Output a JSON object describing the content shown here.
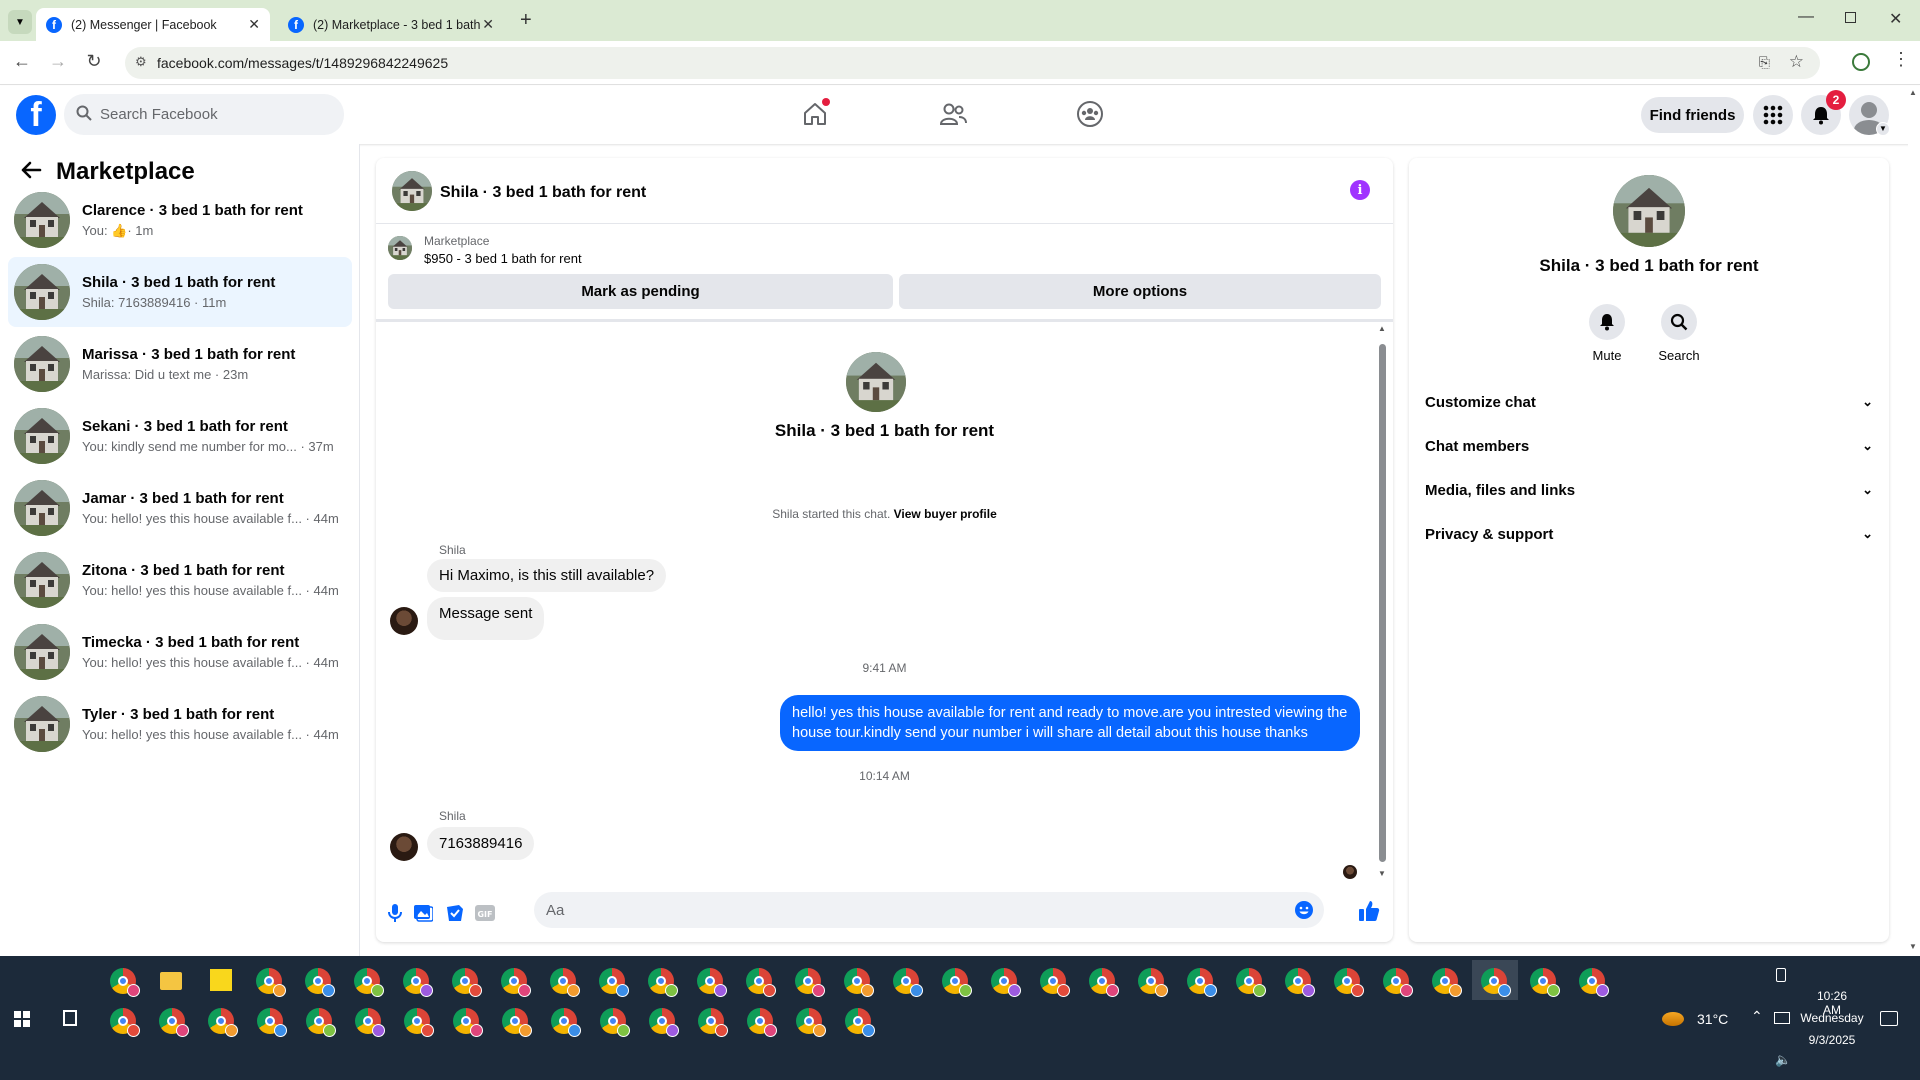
{
  "browser": {
    "tabs": [
      {
        "title": "(2) Messenger | Facebook",
        "active": true
      },
      {
        "title": "(2) Marketplace - 3 bed 1 bath",
        "active": false
      }
    ],
    "url": "facebook.com/messages/t/1489296842249625"
  },
  "header": {
    "search_placeholder": "Search Facebook",
    "find_friends": "Find friends",
    "notification_count": "2",
    "brand_color": "#0866ff"
  },
  "sidebar": {
    "title": "Marketplace",
    "conversations": [
      {
        "name": "Clarence · 3 bed 1 bath for rent",
        "preview": "You: ",
        "time": "· 1m",
        "has_like": true
      },
      {
        "name": "Shila · 3 bed 1 bath for rent",
        "preview": "Shila: 7163889416 · 11m",
        "selected": true
      },
      {
        "name": "Marissa · 3 bed 1 bath for rent",
        "preview": "Marissa: Did u text me · 23m"
      },
      {
        "name": "Sekani · 3 bed 1 bath for rent",
        "preview": "You: kindly send me number for mo... · 37m"
      },
      {
        "name": "Jamar · 3 bed 1 bath for rent",
        "preview": "You: hello! yes this house available f... · 44m"
      },
      {
        "name": "Zitona · 3 bed 1 bath for rent",
        "preview": "You: hello! yes this house available f... · 44m"
      },
      {
        "name": "Timecka · 3 bed 1 bath for rent",
        "preview": "You: hello! yes this house available f... · 44m"
      },
      {
        "name": "Tyler · 3 bed 1 bath for rent",
        "preview": "You: hello! yes this house available f... · 44m"
      }
    ]
  },
  "chat": {
    "title": "Shila · 3 bed 1 bath for rent",
    "marketplace_label": "Marketplace",
    "listing": "$950 - 3 bed 1 bath for rent",
    "mark_pending": "Mark as pending",
    "more_options": "More options",
    "intro_name": "Shila · 3 bed 1 bath for rent",
    "started_text": "Shila started this chat. ",
    "view_profile": "View buyer profile",
    "sender1": "Shila",
    "msg1": "Hi Maximo, is this still available?",
    "msg2": "Message sent",
    "time1": "9:41 AM",
    "my_msg": "hello! yes this house available for rent and ready to move.are you intrested viewing the house tour.kindly send your number i will share all detail about this house thanks",
    "time2": "10:14 AM",
    "sender2": "Shila",
    "msg3": "7163889416",
    "composer_placeholder": "Aa"
  },
  "details": {
    "name": "Shila · 3 bed 1 bath for rent",
    "mute": "Mute",
    "search": "Search",
    "sections": [
      "Customize chat",
      "Chat members",
      "Media, files and links",
      "Privacy & support"
    ]
  },
  "taskbar": {
    "weather": "31°C",
    "time": "10:26 AM",
    "day": "Wednesday",
    "date": "9/3/2025"
  }
}
